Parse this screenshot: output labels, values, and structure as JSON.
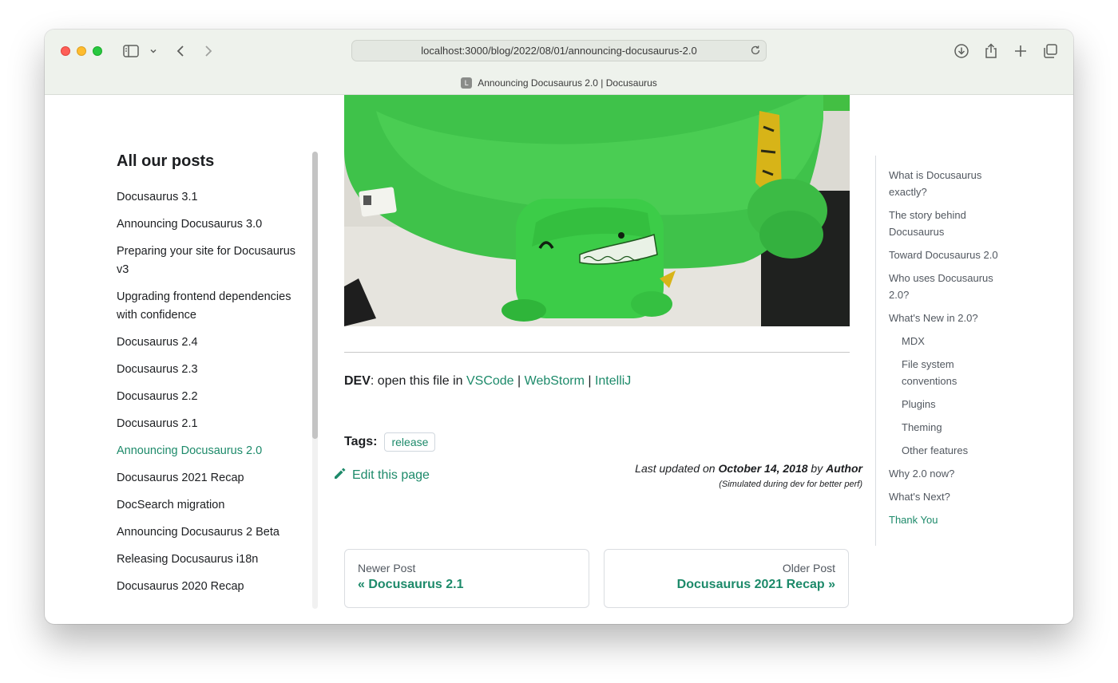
{
  "browser": {
    "url": "localhost:3000/blog/2022/08/01/announcing-docusaurus-2.0",
    "tab_title": "Announcing Docusaurus 2.0 | Docusaurus",
    "favicon_letter": "L"
  },
  "sidebar": {
    "title": "All our posts",
    "items": [
      {
        "label": "Docusaurus 3.1"
      },
      {
        "label": "Announcing Docusaurus 3.0"
      },
      {
        "label": "Preparing your site for Docusaurus v3"
      },
      {
        "label": "Upgrading frontend dependencies with confidence"
      },
      {
        "label": "Docusaurus 2.4"
      },
      {
        "label": "Docusaurus 2.3"
      },
      {
        "label": "Docusaurus 2.2"
      },
      {
        "label": "Docusaurus 2.1"
      },
      {
        "label": "Announcing Docusaurus 2.0",
        "active": true
      },
      {
        "label": "Docusaurus 2021 Recap"
      },
      {
        "label": "DocSearch migration"
      },
      {
        "label": "Announcing Docusaurus 2 Beta"
      },
      {
        "label": "Releasing Docusaurus i18n"
      },
      {
        "label": "Docusaurus 2020 Recap"
      }
    ]
  },
  "article": {
    "dev_label": "DEV",
    "dev_text": ": open this file in ",
    "editors": [
      "VSCode",
      "WebStorm",
      "IntelliJ"
    ],
    "separator": " | ",
    "tags_label": "Tags:",
    "tags": [
      "release"
    ],
    "edit_label": "Edit this page",
    "updated_prefix": "Last updated on ",
    "updated_date": "October 14, 2018",
    "updated_by": " by ",
    "updated_author": "Author",
    "updated_note": "(Simulated during dev for better perf)"
  },
  "pager": {
    "newer_sub": "Newer Post",
    "newer_label": "« Docusaurus 2.1",
    "older_sub": "Older Post",
    "older_label": "Docusaurus 2021 Recap »"
  },
  "toc": {
    "items": [
      {
        "label": "What is Docusaurus exactly?"
      },
      {
        "label": "The story behind Docusaurus"
      },
      {
        "label": "Toward Docusaurus 2.0"
      },
      {
        "label": "Who uses Docusaurus 2.0?"
      },
      {
        "label": "What's New in 2.0?"
      },
      {
        "label": "MDX",
        "sub": true
      },
      {
        "label": "File system conventions",
        "sub": true
      },
      {
        "label": "Plugins",
        "sub": true
      },
      {
        "label": "Theming",
        "sub": true
      },
      {
        "label": "Other features",
        "sub": true
      },
      {
        "label": "Why 2.0 now?"
      },
      {
        "label": "What's Next?"
      },
      {
        "label": "Thank You",
        "active": true
      }
    ]
  },
  "colors": {
    "accent": "#1d8a6a",
    "text": "#1c1e21",
    "muted": "#525860"
  }
}
